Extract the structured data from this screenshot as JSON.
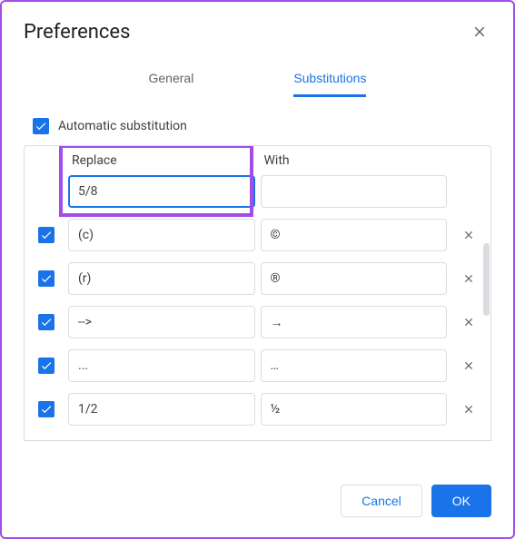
{
  "dialog": {
    "title": "Preferences",
    "tabs": {
      "general": "General",
      "substitutions": "Substitutions"
    },
    "auto_sub_label": "Automatic substitution",
    "headers": {
      "replace": "Replace",
      "with": "With"
    },
    "new_entry": {
      "replace": "5/8",
      "with": ""
    },
    "rows": [
      {
        "replace": "(c)",
        "with": "©"
      },
      {
        "replace": "(r)",
        "with": "®"
      },
      {
        "replace": "-->",
        "with": "→"
      },
      {
        "replace": "...",
        "with": "…"
      },
      {
        "replace": "1/2",
        "with": "½"
      }
    ],
    "buttons": {
      "cancel": "Cancel",
      "ok": "OK"
    }
  }
}
